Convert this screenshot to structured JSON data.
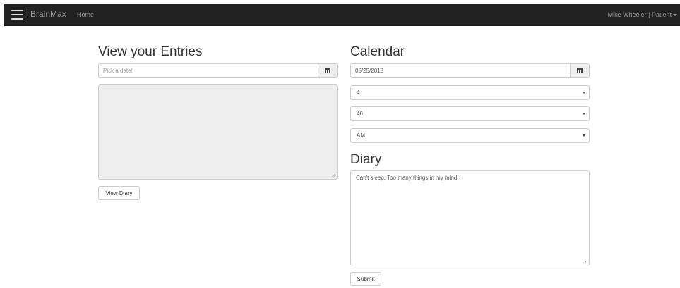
{
  "navbar": {
    "brand": "BrainMax",
    "home_link": "Home",
    "user_menu": "Mike Wheeler | Patient",
    "menu_icon": "hamburger-menu-icon"
  },
  "entries": {
    "title": "View your Entries",
    "date_placeholder": "Pick a date!",
    "date_value": "",
    "calendar_icon": "calendar-icon",
    "entry_text": "",
    "view_button": "View Diary"
  },
  "calendar": {
    "title": "Calendar",
    "date_value": "05/25/2018",
    "calendar_icon": "calendar-icon",
    "hour_selected": "4",
    "minute_selected": "40",
    "ampm_selected": "AM"
  },
  "diary": {
    "title": "Diary",
    "text": "Can't sleep. Too many things in my mind!",
    "submit_button": "Submit"
  }
}
